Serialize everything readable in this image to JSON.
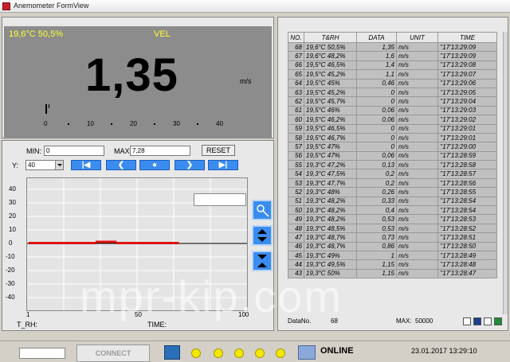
{
  "window": {
    "title": "Anemometer FormView"
  },
  "readout": {
    "temp_rh": "19,6°C 50,5%",
    "mode": "VEL",
    "value": "1,35",
    "unit": "m/s",
    "scale_ticks": [
      "0",
      "10",
      "20",
      "30",
      "40"
    ]
  },
  "controls": {
    "min_label": "MIN:",
    "min_value": "0",
    "max_label": "MAX:",
    "max_value": "7,28",
    "reset_label": "RESET",
    "y_label": "Y:",
    "y_value": "40",
    "nav_buttons": [
      "first",
      "prev",
      "play",
      "next",
      "last"
    ]
  },
  "plot": {
    "y_ticks": [
      "40",
      "30",
      "20",
      "10",
      "0",
      "-10",
      "-20",
      "-30",
      "-40"
    ],
    "x_ticks": [
      "1",
      "50",
      "100"
    ],
    "trh_label": "T_RH:",
    "time_label": "TIME:",
    "series_color": "#e01010"
  },
  "table": {
    "headers": [
      "NO.",
      "T&RH",
      "DATA",
      "UNIT",
      "TIME"
    ],
    "rows": [
      [
        "68",
        "19,6°C 50,5%",
        "1,35",
        "m/s",
        "’’17’13:29:09"
      ],
      [
        "67",
        "19,6°C 48,2%",
        "1,6",
        "m/s",
        "’’17’13:29:09"
      ],
      [
        "66",
        "19,5°C 46,5%",
        "1,4",
        "m/s",
        "’’17’13:29:08"
      ],
      [
        "65",
        "19,5°C 45,2%",
        "1,1",
        "m/s",
        "’’17’13:29:07"
      ],
      [
        "64",
        "19,5°C 45%",
        "0,46",
        "m/s",
        "’’17’13:29:06"
      ],
      [
        "63",
        "19,5°C 45,2%",
        "0",
        "m/s",
        "’’17’13:29:05"
      ],
      [
        "62",
        "19,5°C 45,7%",
        "0",
        "m/s",
        "’’17’13:29:04"
      ],
      [
        "61",
        "19,5°C 46%",
        "0,06",
        "m/s",
        "’’17’13:29:03"
      ],
      [
        "60",
        "19,5°C 46,2%",
        "0,06",
        "m/s",
        "’’17’13:29:02"
      ],
      [
        "59",
        "19,5°C 46,5%",
        "0",
        "m/s",
        "’’17’13:29:01"
      ],
      [
        "58",
        "19,5°C 46,7%",
        "0",
        "m/s",
        "’’17’13:29:01"
      ],
      [
        "57",
        "19,5°C 47%",
        "0",
        "m/s",
        "’’17’13:29:00"
      ],
      [
        "56",
        "19,5°C 47%",
        "0,06",
        "m/s",
        "’’17’13:28:59"
      ],
      [
        "55",
        "19,3°C 47,2%",
        "0,13",
        "m/s",
        "’’17’13:28:58"
      ],
      [
        "54",
        "19,3°C 47,5%",
        "0,2",
        "m/s",
        "’’17’13:28:57"
      ],
      [
        "53",
        "19,3°C 47,7%",
        "0,2",
        "m/s",
        "’’17’13:28:56"
      ],
      [
        "52",
        "19,3°C 48%",
        "0,26",
        "m/s",
        "’’17’13:28:55"
      ],
      [
        "51",
        "19,3°C 48,2%",
        "0,33",
        "m/s",
        "’’17’13:28:54"
      ],
      [
        "50",
        "19,3°C 48,2%",
        "0,4",
        "m/s",
        "’’17’13:28:54"
      ],
      [
        "49",
        "19,3°C 48,2%",
        "0,53",
        "m/s",
        "’’17’13:28:53"
      ],
      [
        "48",
        "19,3°C 48,5%",
        "0,53",
        "m/s",
        "’’17’13:28:52"
      ],
      [
        "47",
        "19,3°C 48,7%",
        "0,73",
        "m/s",
        "’’17’13:28:51"
      ],
      [
        "46",
        "19,3°C 48,7%",
        "0,86",
        "m/s",
        "’’17’13:28:50"
      ],
      [
        "45",
        "19,3°C 49%",
        "1",
        "m/s",
        "’’17’13:28:49"
      ],
      [
        "44",
        "19,3°C 49,5%",
        "1,15",
        "m/s",
        "’’17’13:28:48"
      ],
      [
        "43",
        "19,3°C 50%",
        "1,15",
        "m/s",
        "’’17’13:28:47"
      ]
    ],
    "datano_label": "DataNo.",
    "datano_value": "68",
    "max_label": "MAX:",
    "max_value": "50000"
  },
  "status": {
    "connect_label": "CONNECT",
    "online_label": "ONLINE",
    "datetime": "23.01.2017 13:29:10",
    "led_color": "#f4e800"
  },
  "watermark": "mpr-kip.com"
}
